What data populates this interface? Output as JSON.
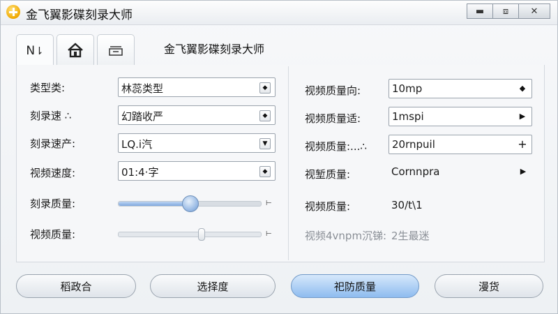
{
  "window": {
    "title": "金飞翼影碟刻录大师",
    "controls": {
      "minimize": "▬",
      "maximize": "⧈",
      "close": "✕"
    }
  },
  "tabs": [
    {
      "label": "N",
      "icon": "sort-arrows-icon"
    },
    {
      "label": "",
      "icon": "home-icon"
    },
    {
      "label": "",
      "icon": "inbox-icon"
    }
  ],
  "tab_title": "金飞翼影碟刻录大师",
  "left": {
    "rows": [
      {
        "label": "类型类:",
        "value": "林蕊类型",
        "arrow": "◆"
      },
      {
        "label": "刻录速 ∴",
        "value": "幻踏收严",
        "arrow": "◆"
      },
      {
        "label": "刻录速产:",
        "value": "LQ.i汽",
        "arrow": "▼"
      },
      {
        "label": "视频速度:",
        "value": "01:4·字",
        "arrow": "◆"
      }
    ],
    "slider1": {
      "label": "刻录质量:",
      "value": 0.5,
      "end": "⊢"
    },
    "slider2": {
      "label": "视频质量:",
      "value": 0.58,
      "end": "⊢"
    }
  },
  "right": {
    "rows": [
      {
        "label": "视频质量向:",
        "value": "10mp",
        "arrow": "◆"
      },
      {
        "label": "视频质量适:",
        "value": "1mspi",
        "arrow": "▶"
      },
      {
        "label": "视频质量:...∴",
        "value": "20rnpuil",
        "arrow": "+"
      },
      {
        "label": "视堑质量:",
        "value": "Cornnpra",
        "arrow": "▶"
      },
      {
        "label": "视频质量:",
        "value": "30/t\\1",
        "arrow": ""
      },
      {
        "label": "视频4vnpm沉锑:",
        "value": "2生最迷",
        "arrow": ""
      }
    ]
  },
  "buttons": [
    {
      "label": "稻政合"
    },
    {
      "label": "选择度"
    },
    {
      "label": "祀防质量"
    },
    {
      "label": "漫货"
    }
  ]
}
